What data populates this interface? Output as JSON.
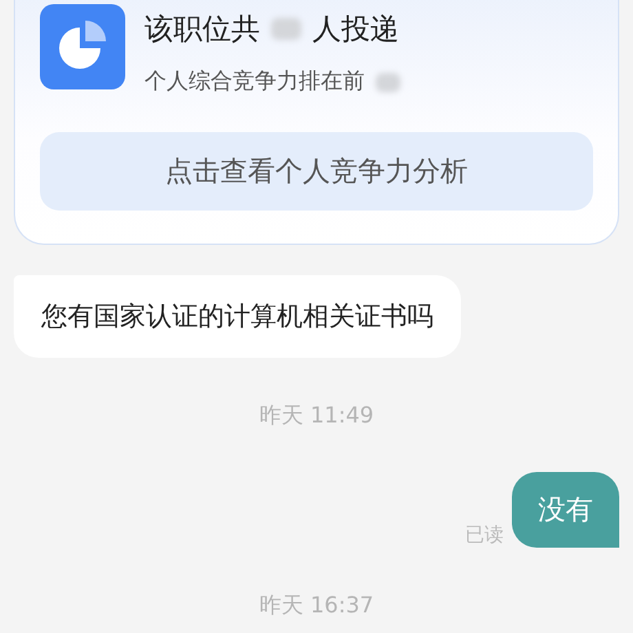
{
  "card": {
    "title_before": "该职位共",
    "title_count": {
      "blurred": true
    },
    "title_after": "人投递",
    "subtitle": "个人综合竞争力排在前",
    "subtitle_rank": {
      "blurred": true
    },
    "button": "点击查看个人竞争力分析"
  },
  "messages": [
    {
      "kind": "received",
      "text": "您有国家认证的计算机相关证书吗"
    },
    {
      "kind": "time",
      "text": "昨天 11:49"
    },
    {
      "kind": "sent",
      "text": "没有",
      "status": "已读"
    },
    {
      "kind": "time",
      "text": "昨天 16:37"
    }
  ]
}
